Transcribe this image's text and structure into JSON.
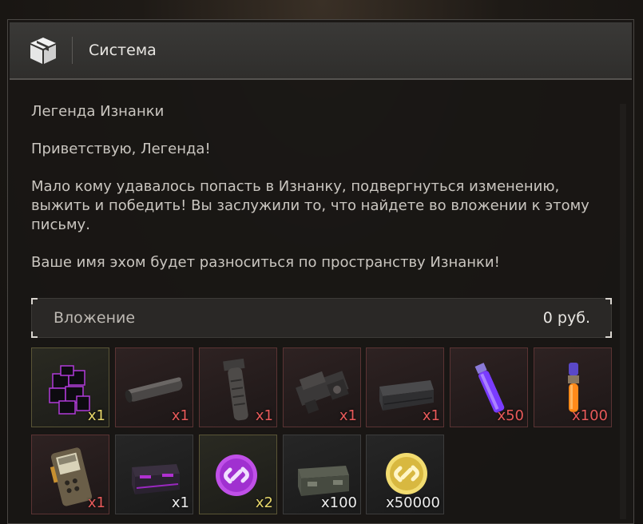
{
  "header": {
    "title": "Система",
    "icon": "package-icon"
  },
  "message": {
    "subject": "Легенда Изнанки",
    "greeting": "Приветствую, Легенда!",
    "paragraph1": "Мало кому удавалось попасть в Изнанку, подвергнуться изменению, выжить и победить! Вы заслужили то, что найдете во вложении к этому письму.",
    "paragraph2": "Ваше имя эхом будет разноситься по пространству Изнанки!"
  },
  "attachment": {
    "label": "Вложение",
    "price": "0  руб."
  },
  "colors": {
    "rarity_gold": "#e6d66a",
    "rarity_red": "#e85a5a",
    "rarity_white": "#ededed"
  },
  "items": [
    {
      "name": "purple-cube-cluster-item",
      "qty": "x1",
      "rarity": "gold"
    },
    {
      "name": "suppressor-item",
      "qty": "x1",
      "rarity": "red"
    },
    {
      "name": "foregrip-item",
      "qty": "x1",
      "rarity": "red"
    },
    {
      "name": "weapon-mount-item",
      "qty": "x1",
      "rarity": "red"
    },
    {
      "name": "ammo-case-item",
      "qty": "x1",
      "rarity": "red"
    },
    {
      "name": "purple-lightstick-item",
      "qty": "x50",
      "rarity": "red"
    },
    {
      "name": "orange-vial-item",
      "qty": "x100",
      "rarity": "red"
    },
    {
      "name": "handheld-detector-item",
      "qty": "x1",
      "rarity": "red"
    },
    {
      "name": "purple-crate-item",
      "qty": "x1",
      "rarity": "white"
    },
    {
      "name": "purple-link-token-item",
      "qty": "x2",
      "rarity": "gold"
    },
    {
      "name": "military-crate-item",
      "qty": "x100",
      "rarity": "white"
    },
    {
      "name": "gold-link-token-item",
      "qty": "x50000",
      "rarity": "white"
    }
  ]
}
